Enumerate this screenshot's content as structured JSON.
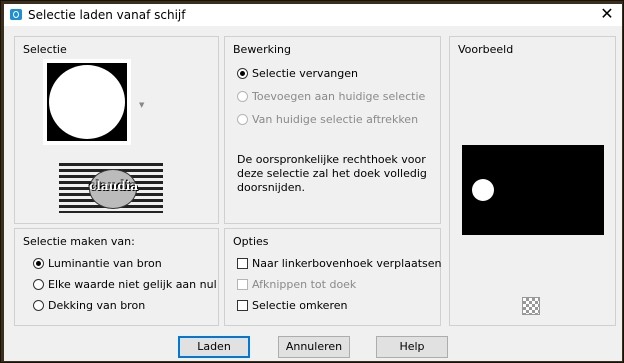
{
  "window": {
    "title": "Selectie laden vanaf schijf"
  },
  "selectie": {
    "title": "Selectie",
    "thumb_text": "claudia"
  },
  "bewerking": {
    "title": "Bewerking",
    "options": [
      {
        "label": "Selectie vervangen",
        "selected": true,
        "enabled": true
      },
      {
        "label": "Toevoegen aan huidige selectie",
        "selected": false,
        "enabled": false
      },
      {
        "label": "Van huidige selectie aftrekken",
        "selected": false,
        "enabled": false
      }
    ],
    "description": "De oorspronkelijke rechthoek voor deze selectie zal het doek volledig doorsnijden."
  },
  "voorbeeld": {
    "title": "Voorbeeld"
  },
  "maken_van": {
    "title": "Selectie maken van:",
    "options": [
      {
        "label": "Luminantie van bron",
        "selected": true
      },
      {
        "label": "Elke waarde niet gelijk aan nul",
        "selected": false
      },
      {
        "label": "Dekking van bron",
        "selected": false
      }
    ]
  },
  "opties": {
    "title": "Opties",
    "options": [
      {
        "label": "Naar linkerbovenhoek verplaatsen",
        "checked": false,
        "enabled": true
      },
      {
        "label": "Afknippen tot doek",
        "checked": false,
        "enabled": false
      },
      {
        "label": "Selectie omkeren",
        "checked": false,
        "enabled": true
      }
    ]
  },
  "buttons": {
    "load": "Laden",
    "cancel": "Annuleren",
    "help": "Help"
  }
}
